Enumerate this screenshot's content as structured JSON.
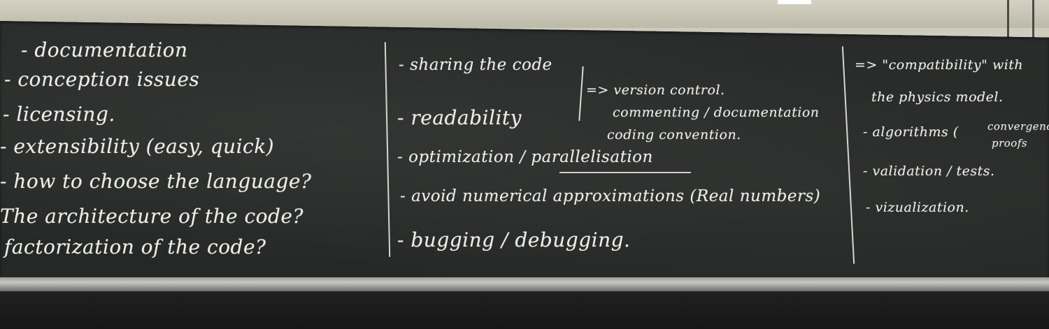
{
  "left_column": [
    "- documentation",
    "- conception issues",
    "- licensing.",
    "- extensibility (easy, quick)",
    "- how to choose the language?",
    "The architecture of the code?",
    "factorization of the code?"
  ],
  "middle_column": {
    "items": [
      "- sharing the code",
      "- readability",
      "- optimization / parallelisation",
      "- avoid numerical approximations (Real numbers)",
      "- bugging / debugging."
    ],
    "arrow_notes": [
      "=> version control.",
      "commenting / documentation",
      "coding convention."
    ]
  },
  "right_column": {
    "lines": [
      "=> \"compatibility\" with",
      "the physics model.",
      "- algorithms (",
      "- validation / tests.",
      "- vizualization."
    ],
    "bracket_note": [
      "convergence",
      "proofs"
    ]
  }
}
